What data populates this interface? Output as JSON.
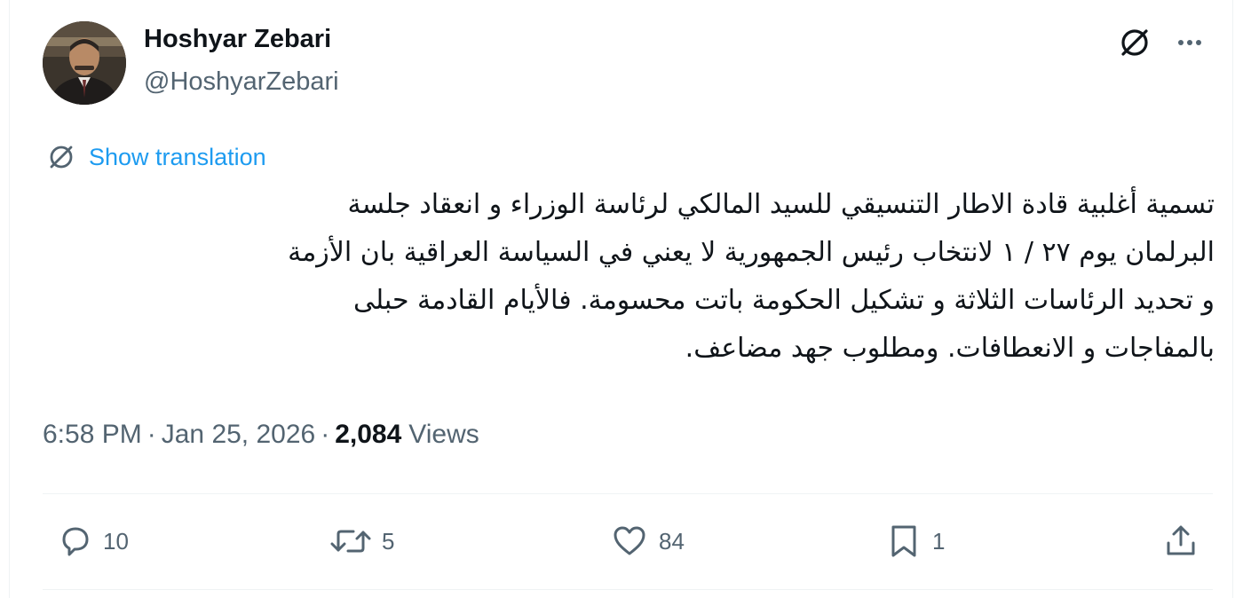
{
  "author": {
    "display_name": "Hoshyar Zebari",
    "handle": "@HoshyarZebari"
  },
  "header": {
    "grok_icon": "grok-icon",
    "more_icon": "more-horizontal-icon"
  },
  "translation": {
    "label": "Show translation",
    "icon": "grok-icon"
  },
  "tweet": {
    "lines": [
      "تسمية أغلبية قادة الاطار التنسيقي للسيد المالكي لرئاسة الوزراء و انعقاد جلسة",
      "البرلمان يوم ٢٧ / ١ لانتخاب رئيس الجمهورية لا يعني في السياسة العراقية بان الأزمة",
      "و تحديد الرئاسات الثلاثة و تشكيل الحكومة باتت محسومة. فالأيام القادمة حبلى",
      "بالمفاجات و الانعطافات. ومطلوب جهد مضاعف."
    ]
  },
  "meta": {
    "time": "6:58 PM",
    "date": "Jan 25, 2026",
    "separator": "·",
    "views_count": "2,084",
    "views_label": "Views"
  },
  "actions": {
    "replies": "10",
    "reposts": "5",
    "likes": "84",
    "bookmarks": "1"
  },
  "colors": {
    "text_primary": "#0f1419",
    "text_secondary": "#536471",
    "accent": "#1d9bf0",
    "divider": "#eff3f4"
  }
}
